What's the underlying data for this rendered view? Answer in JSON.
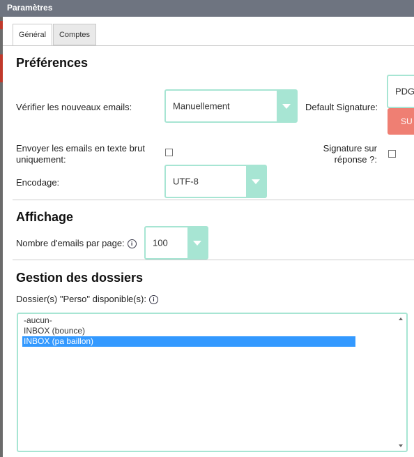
{
  "window": {
    "title": "Paramètres"
  },
  "tabs": [
    {
      "label": "Général"
    },
    {
      "label": "Comptes"
    }
  ],
  "preferences": {
    "heading": "Préférences",
    "check_new_emails": {
      "label": "Vérifier les nouveaux emails:",
      "value": "Manuellement"
    },
    "default_signature": {
      "label": "Default Signature:",
      "value": "PDG",
      "button_label": "SU"
    },
    "plain_text": {
      "label": "Envoyer les emails en texte brut uniquement:",
      "checked": false
    },
    "signature_reply": {
      "label": "Signature sur réponse ?:",
      "checked": false
    },
    "encoding": {
      "label": "Encodage:",
      "value": "UTF-8"
    }
  },
  "display": {
    "heading": "Affichage",
    "per_page": {
      "label": "Nombre d'emails par page:",
      "value": "100"
    }
  },
  "folders": {
    "heading": "Gestion des dossiers",
    "perso_label": "Dossier(s) \"Perso\" disponible(s):",
    "options": [
      "-aucun-",
      "INBOX (bounce)",
      "INBOX (pa baillon)"
    ],
    "selected": "INBOX (pa baillon)"
  },
  "icons": {
    "info": "info-icon",
    "dropdown": "chevron-down-icon"
  },
  "colors": {
    "accent": "#a7e5d3",
    "danger": "#ef7f73",
    "selection": "#3399ff"
  }
}
